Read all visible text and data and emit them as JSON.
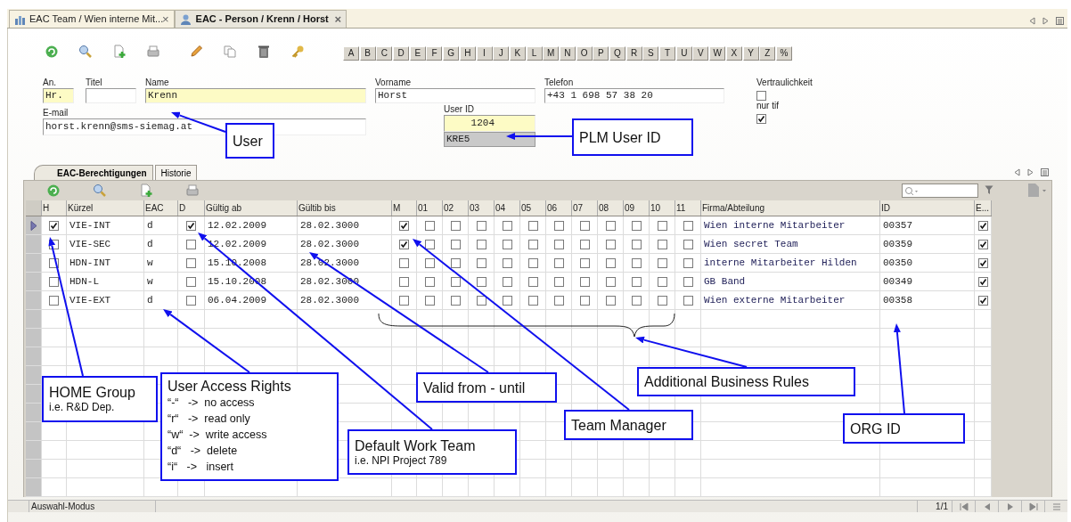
{
  "tabs": [
    {
      "label": "EAC Team / Wien interne Mit...",
      "close": "×",
      "selected": false
    },
    {
      "label": "EAC - Person / Krenn / Horst",
      "close": "×",
      "selected": true
    }
  ],
  "letters": [
    "A",
    "B",
    "C",
    "D",
    "E",
    "F",
    "G",
    "H",
    "I",
    "J",
    "K",
    "L",
    "M",
    "N",
    "O",
    "P",
    "Q",
    "R",
    "S",
    "T",
    "U",
    "V",
    "W",
    "X",
    "Y",
    "Z",
    "%"
  ],
  "form": {
    "fields": [
      {
        "kind": "text",
        "label": "An.",
        "value": "Hr.",
        "required": true
      },
      {
        "kind": "text",
        "label": "Titel",
        "required": false
      },
      {
        "kind": "text",
        "label": "Name",
        "value": "Krenn",
        "required": true
      },
      {
        "kind": "text",
        "label": "Vorname",
        "value": "Horst",
        "required": false
      },
      {
        "kind": "text",
        "label": "Telefon",
        "value": "+43 1 698 57 38 20",
        "required": false
      },
      {
        "kind": "checkbox",
        "label": "Vertraulichkeit",
        "checked": false
      },
      {
        "kind": "text",
        "label": "E-mail",
        "value": "horst.krenn@sms-siemag.at",
        "required": false
      },
      {
        "kind": "text",
        "label": "User ID",
        "value": "1204",
        "required": true,
        "code": "KRE5"
      },
      {
        "kind": "checkbox",
        "label": "nur tif",
        "checked": true
      }
    ]
  },
  "subtabs": [
    {
      "label": "EAC-Berechtigungen",
      "selected": true
    },
    {
      "label": "Historie",
      "selected": false
    }
  ],
  "table": {
    "columns": [
      "H",
      "Kürzel",
      "EAC",
      "D",
      "Gültig ab",
      "Gültib bis",
      "M",
      "01",
      "02",
      "03",
      "04",
      "05",
      "06",
      "07",
      "08",
      "09",
      "10",
      "11",
      "Firma/Abteilung",
      "ID",
      "E..."
    ],
    "rows": [
      {
        "selected": true,
        "h": true,
        "kurzel": "VIE-INT",
        "eac": "d",
        "d": true,
        "gultig_ab": "12.02.2009",
        "gultig_bis": "28.02.3000",
        "m": true,
        "flags": [
          false,
          false,
          false,
          false,
          false,
          false,
          false,
          false,
          false,
          false,
          false
        ],
        "firma": "Wien interne Mitarbeiter",
        "id": "00357",
        "e": true
      },
      {
        "selected": false,
        "h": false,
        "kurzel": "VIE-SEC",
        "eac": "d",
        "d": false,
        "gultig_ab": "12.02.2009",
        "gultig_bis": "28.02.3000",
        "m": true,
        "flags": [
          false,
          false,
          false,
          false,
          false,
          false,
          false,
          false,
          false,
          false,
          false
        ],
        "firma": "Wien secret Team",
        "id": "00359",
        "e": true
      },
      {
        "selected": false,
        "h": false,
        "kurzel": "HDN-INT",
        "eac": "w",
        "d": false,
        "gultig_ab": "15.10.2008",
        "gultig_bis": "28.02.3000",
        "m": false,
        "flags": [
          false,
          false,
          false,
          false,
          false,
          false,
          false,
          false,
          false,
          false,
          false
        ],
        "firma": "interne Mitarbeiter Hilden",
        "id": "00350",
        "e": true
      },
      {
        "selected": false,
        "h": false,
        "kurzel": "HDN-L",
        "eac": "w",
        "d": false,
        "gultig_ab": "15.10.2008",
        "gultig_bis": "28.02.3000",
        "m": false,
        "flags": [
          false,
          false,
          false,
          false,
          false,
          false,
          false,
          false,
          false,
          false,
          false
        ],
        "firma": "GB Band",
        "id": "00349",
        "e": true
      },
      {
        "selected": false,
        "h": false,
        "kurzel": "VIE-EXT",
        "eac": "d",
        "d": false,
        "gultig_ab": "06.04.2009",
        "gultig_bis": "28.02.3000",
        "m": false,
        "flags": [
          false,
          false,
          false,
          false,
          false,
          false,
          false,
          false,
          false,
          false,
          false
        ],
        "firma": "Wien externe Mitarbeiter",
        "id": "00358",
        "e": true
      }
    ]
  },
  "status_bar": {
    "mode": "Auswahl-Modus",
    "page": "1/1"
  },
  "annotations": [
    {
      "title": "User"
    },
    {
      "title": "PLM User ID"
    },
    {
      "title": "HOME Group",
      "subtitle": "i.e. R&D Dep."
    },
    {
      "title": "User Access Rights",
      "lines": [
        "“-“   ->  no access",
        "“r“   ->  read only",
        "“w“  ->  write access",
        "“d“   ->  delete",
        "“i“   ->   insert"
      ]
    },
    {
      "title": "Default Work Team",
      "subtitle": "i.e. NPI Project 789"
    },
    {
      "title": "Valid from - until"
    },
    {
      "title": "Team Manager"
    },
    {
      "title": "Additional Business Rules"
    },
    {
      "title": "ORG ID"
    }
  ]
}
